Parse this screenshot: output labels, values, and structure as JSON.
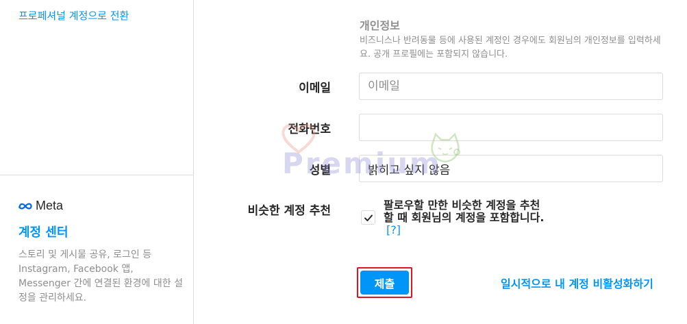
{
  "sidebar": {
    "switch_professional": "프로페셔널 계정으로 전환",
    "meta_logo_text": "Meta",
    "accounts_center": "계정 센터",
    "accounts_center_desc": "스토리 및 게시물 공유, 로그인 등 Instagram, Facebook 앱, Messenger 간에 연결된 환경에 대한 설정을 관리하세요."
  },
  "personal_info": {
    "title": "개인정보",
    "description": "비즈니스나 반려동물 등에 사용된 계정인 경우에도 회원님의 개인정보를 입력하세요. 공개 프로필에는 포함되지 않습니다."
  },
  "fields": {
    "email_label": "이메일",
    "email_placeholder": "이메일",
    "email_value": "",
    "phone_label": "전화번호",
    "phone_value": "",
    "gender_label": "성별",
    "gender_value": "밝히고 싶지 않음",
    "suggest_label": "비슷한 계정 추천",
    "suggest_text": "팔로우할 만한 비슷한 계정을 추천할 때 회원님의 계정을 포함합니다.",
    "suggest_help": "[?]",
    "suggest_checked": true
  },
  "actions": {
    "submit": "제출",
    "deactivate": "일시적으로 내 계정 비활성화하기"
  },
  "watermark": {
    "text": "Premium"
  },
  "colors": {
    "accent": "#0095f6",
    "highlight_border": "#e0141e",
    "border": "#dbdbdb",
    "muted_text": "#8e8e8e"
  }
}
